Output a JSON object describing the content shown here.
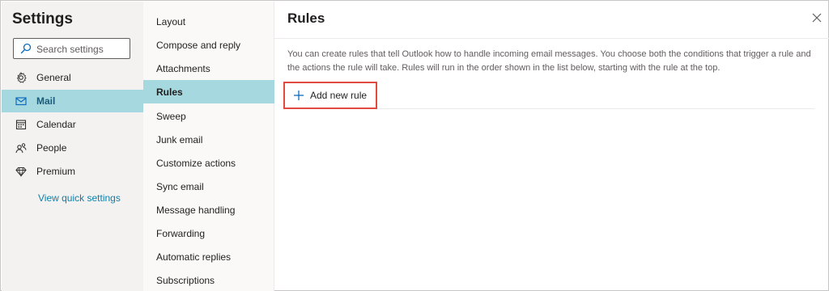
{
  "settings": {
    "title": "Settings",
    "search_placeholder": "Search settings",
    "nav": [
      {
        "label": "General",
        "icon": "gear-icon",
        "active": false
      },
      {
        "label": "Mail",
        "icon": "mail-icon",
        "active": true
      },
      {
        "label": "Calendar",
        "icon": "calendar-icon",
        "active": false
      },
      {
        "label": "People",
        "icon": "people-icon",
        "active": false
      },
      {
        "label": "Premium",
        "icon": "diamond-icon",
        "active": false
      }
    ],
    "quick_settings_link": "View quick settings"
  },
  "mail_menu": {
    "items": [
      {
        "label": "Layout"
      },
      {
        "label": "Compose and reply"
      },
      {
        "label": "Attachments"
      },
      {
        "label": "Rules",
        "active": true
      },
      {
        "label": "Sweep"
      },
      {
        "label": "Junk email"
      },
      {
        "label": "Customize actions"
      },
      {
        "label": "Sync email"
      },
      {
        "label": "Message handling"
      },
      {
        "label": "Forwarding"
      },
      {
        "label": "Automatic replies"
      },
      {
        "label": "Subscriptions"
      }
    ]
  },
  "panel": {
    "title": "Rules",
    "description": "You can create rules that tell Outlook how to handle incoming email messages. You choose both the conditions that trigger a rule and the actions the rule will take. Rules will run in the order shown in the list below, starting with the rule at the top.",
    "add_rule_label": "Add new rule"
  },
  "colors": {
    "accent": "#a6d8e0",
    "link": "#0f7ea8",
    "highlight_border": "#e04a3f"
  }
}
